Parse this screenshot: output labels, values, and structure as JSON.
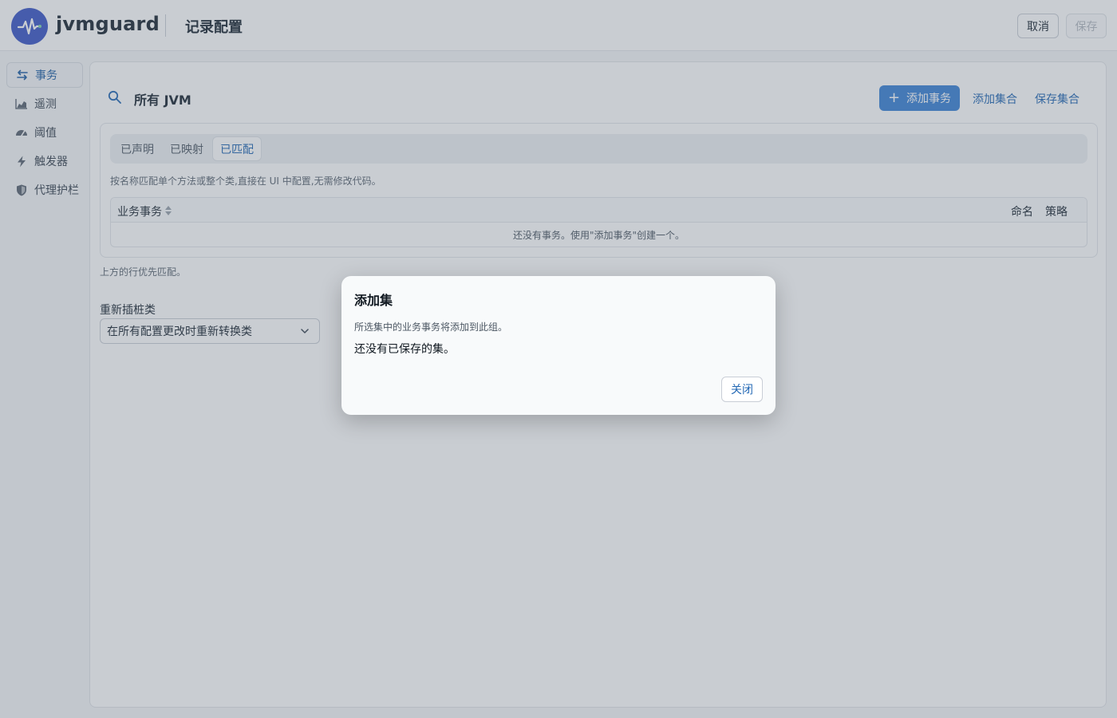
{
  "header": {
    "brand": "jvmguard",
    "page_title": "记录配置",
    "cancel_label": "取消",
    "save_label": "保存"
  },
  "sidebar": {
    "items": [
      {
        "label": "事务",
        "icon": "transactions-icon",
        "active": true
      },
      {
        "label": "遥测",
        "icon": "chart-area-icon",
        "active": false
      },
      {
        "label": "阈值",
        "icon": "gauge-icon",
        "active": false
      },
      {
        "label": "触发器",
        "icon": "lightning-icon",
        "active": false
      },
      {
        "label": "代理护栏",
        "icon": "shield-icon",
        "active": false
      }
    ]
  },
  "main": {
    "scope_title": "所有 JVM",
    "add_transaction_label": "添加事务",
    "add_set_label": "添加集合",
    "save_set_label": "保存集合",
    "tabs": [
      {
        "label": "已声明",
        "active": false
      },
      {
        "label": "已映射",
        "active": false
      },
      {
        "label": "已匹配",
        "active": true
      }
    ],
    "hint": "按名称匹配单个方法或整个类,直接在 UI 中配置,无需修改代码。",
    "table": {
      "col_business_tx": "业务事务",
      "col_naming": "命名",
      "col_policy": "策略",
      "empty_text": "还没有事务。使用\"添加事务\"创建一个。"
    },
    "priority_note": "上方的行优先匹配。",
    "reinstrument_label": "重新插桩类",
    "reinstrument_value": "在所有配置更改时重新转换类"
  },
  "dialog": {
    "title": "添加集",
    "description": "所选集中的业务事务将添加到此组。",
    "empty_text": "还没有已保存的集。",
    "close_label": "关闭"
  },
  "colors": {
    "accent": "#3b82d6",
    "link": "#2368b4",
    "logo_bg": "#3d57c7"
  }
}
